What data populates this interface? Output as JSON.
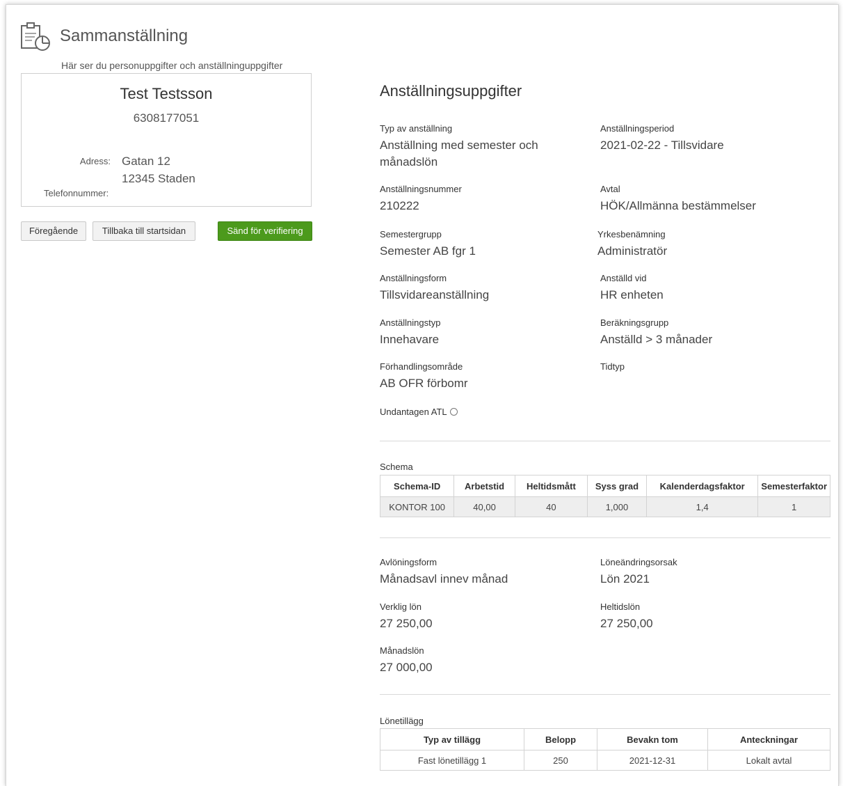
{
  "header": {
    "title": "Sammanställning",
    "subtitle": "Här ser du personuppgifter och anställninguppgifter",
    "icon": "clipboard-chart-icon"
  },
  "person": {
    "name": "Test Testsson",
    "personal_number": "6308177051",
    "address_label": "Adress:",
    "address_line1": "Gatan 12",
    "address_line2": "12345 Staden",
    "phone_label": "Telefonnummer:"
  },
  "buttons": {
    "previous": "Föregående",
    "back_to_start": "Tillbaka till startsidan",
    "send_for_verification": "Sänd för verifiering",
    "send_color": "#4c9a1c"
  },
  "employment": {
    "title": "Anställningsuppgifter",
    "fields": {
      "typ_av_anstallning": {
        "label": "Typ av anställning",
        "value": "Anställning med semester och månadslön"
      },
      "anstallningsperiod": {
        "label": "Anställningsperiod",
        "value": "2021-02-22 - Tillsvidare"
      },
      "anstallningsnummer": {
        "label": "Anställningsnummer",
        "value": "210222"
      },
      "avtal": {
        "label": "Avtal",
        "value": "HÖK/Allmänna bestämmelser"
      },
      "semestergrupp": {
        "label": "Semestergrupp",
        "value": "Semester AB fgr 1"
      },
      "yrkesbenamning": {
        "label": "Yrkesbenämning",
        "value": "Administratör"
      },
      "anstallningsform": {
        "label": "Anställningsform",
        "value": "Tillsvidareanställning"
      },
      "anstalld_vid": {
        "label": "Anställd vid",
        "value": "HR enheten"
      },
      "anstallningstyp": {
        "label": "Anställningstyp",
        "value": "Innehavare"
      },
      "berakningsgrupp": {
        "label": "Beräkningsgrupp",
        "value": "Anställd > 3 månader"
      },
      "forhandlingsomrade": {
        "label": "Förhandlingsområde",
        "value": "AB OFR förbomr"
      },
      "tidtyp": {
        "label": "Tidtyp",
        "value": ""
      }
    },
    "undantagen_atl_label": "Undantagen ATL"
  },
  "schema": {
    "caption": "Schema",
    "columns": [
      "Schema-ID",
      "Arbetstid",
      "Heltidsmått",
      "Syss grad",
      "Kalenderdagsfaktor",
      "Semesterfaktor"
    ],
    "rows": [
      [
        "KONTOR 100",
        "40,00",
        "40",
        "1,000",
        "1,4",
        "1"
      ]
    ]
  },
  "salary": {
    "fields": {
      "avloningsform": {
        "label": "Avlöningsform",
        "value": "Månadsavl innev månad"
      },
      "loneandringsorsak": {
        "label": "Löneändringsorsak",
        "value": "Lön 2021"
      },
      "verklig_lon": {
        "label": "Verklig lön",
        "value": "27 250,00"
      },
      "heltidslon": {
        "label": "Heltidslön",
        "value": "27 250,00"
      },
      "manadslon": {
        "label": "Månadslön",
        "value": "27 000,00"
      }
    }
  },
  "lonetillagg": {
    "caption": "Lönetillägg",
    "columns": [
      "Typ av tillägg",
      "Belopp",
      "Bevakn tom",
      "Anteckningar"
    ],
    "rows": [
      [
        "Fast lönetillägg 1",
        "250",
        "2021-12-31",
        "Lokalt avtal"
      ]
    ]
  }
}
